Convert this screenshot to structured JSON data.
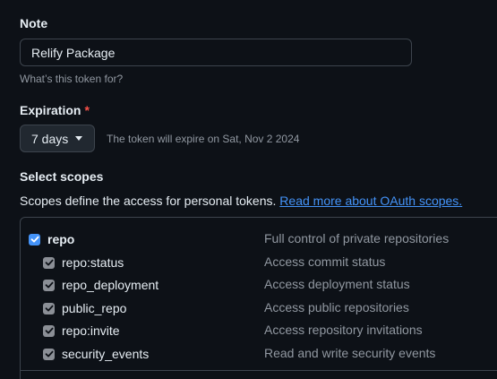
{
  "note": {
    "label": "Note",
    "value": "Relify Package",
    "hint": "What’s this token for?"
  },
  "expiration": {
    "label": "Expiration",
    "required_mark": "*",
    "selected": "7 days",
    "expire_text": "The token will expire on Sat, Nov 2 2024"
  },
  "scopes": {
    "title": "Select scopes",
    "description": "Scopes define the access for personal tokens.",
    "link_text": "Read more about OAuth scopes.",
    "items": [
      {
        "name": "repo",
        "description": "Full control of private repositories",
        "checked": true,
        "main": true
      },
      {
        "name": "repo:status",
        "description": "Access commit status",
        "checked": true,
        "main": false
      },
      {
        "name": "repo_deployment",
        "description": "Access deployment status",
        "checked": true,
        "main": false
      },
      {
        "name": "public_repo",
        "description": "Access public repositories",
        "checked": true,
        "main": false
      },
      {
        "name": "repo:invite",
        "description": "Access repository invitations",
        "checked": true,
        "main": false
      },
      {
        "name": "security_events",
        "description": "Read and write security events",
        "checked": true,
        "main": false
      }
    ]
  },
  "colors": {
    "accent": "#4493f8",
    "required": "#f85149",
    "background": "#0d1117"
  }
}
